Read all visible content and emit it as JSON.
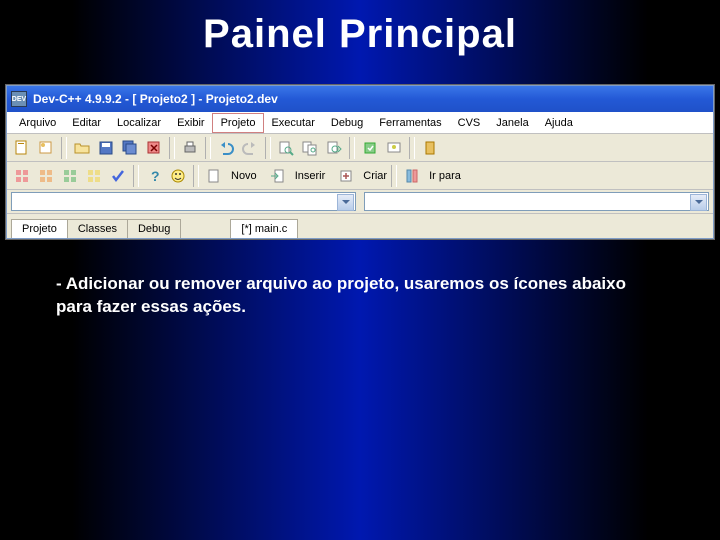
{
  "slide": {
    "title": "Painel Principal"
  },
  "window": {
    "app_icon_text": "DEV",
    "title": "Dev-C++ 4.9.9.2  -  [ Projeto2 ]  -  Projeto2.dev"
  },
  "menu": {
    "arquivo": "Arquivo",
    "editar": "Editar",
    "localizar": "Localizar",
    "exibir": "Exibir",
    "projeto": "Projeto",
    "executar": "Executar",
    "debug": "Debug",
    "ferramentas": "Ferramentas",
    "cvs": "CVS",
    "janela": "Janela",
    "ajuda": "Ajuda"
  },
  "toolbar2": {
    "novo": "Novo",
    "inserir": "Inserir",
    "criar": "Criar",
    "irpara": "Ir para"
  },
  "sidetabs": {
    "projeto": "Projeto",
    "classes": "Classes",
    "debug": "Debug"
  },
  "file_tab": "[*] main.c",
  "caption": "- Adicionar ou remover arquivo ao projeto, usaremos os ícones abaixo para fazer essas ações."
}
